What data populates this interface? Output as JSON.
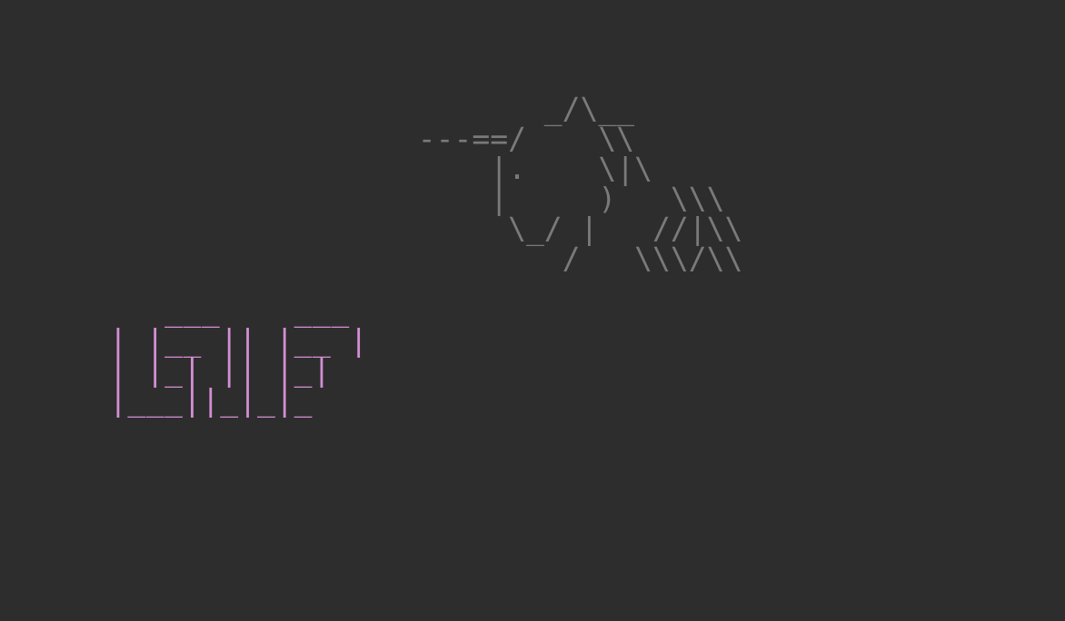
{
  "ascii": {
    "left": "   ___    ___ \n| |__ || |__ |\n| |_| || |_| \n|___||_|_|_  ",
    "right": "         _/\\__       \n  ---==/    \\\\      \n      |.    \\|\\     \n      |     )   \\\\\\   \n       \\_/ |   //|\\\\  \n          /   \\\\\\/\\\\ "
  }
}
